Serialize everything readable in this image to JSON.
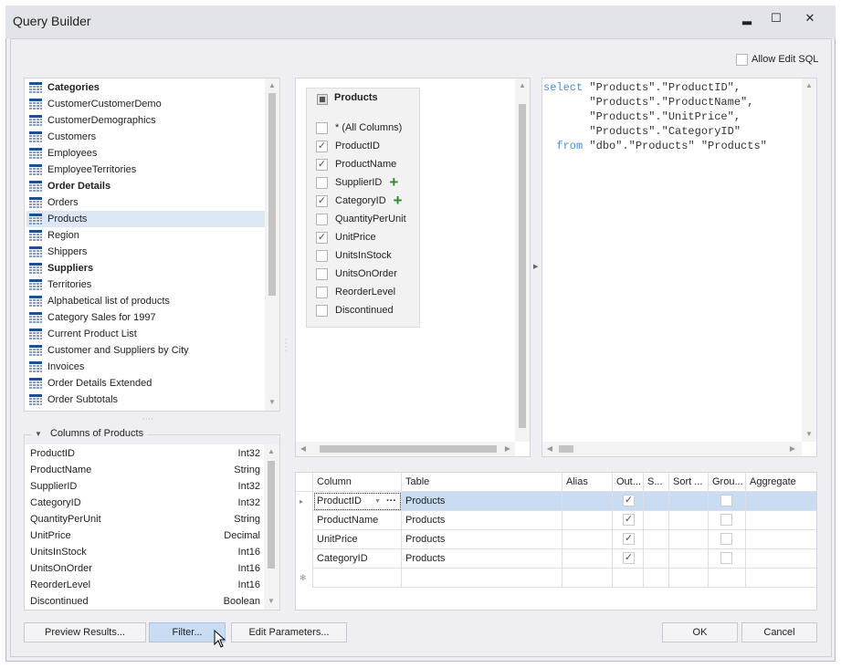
{
  "window": {
    "title": "Query Builder",
    "minimize": "▂",
    "maximize": "☐",
    "close": "✕"
  },
  "allow_edit_sql": {
    "label": "Allow Edit SQL",
    "checked": false
  },
  "tables": [
    {
      "label": "Categories",
      "bold": true
    },
    {
      "label": "CustomerCustomerDemo"
    },
    {
      "label": "CustomerDemographics"
    },
    {
      "label": "Customers"
    },
    {
      "label": "Employees"
    },
    {
      "label": "EmployeeTerritories"
    },
    {
      "label": "Order Details",
      "bold": true
    },
    {
      "label": "Orders"
    },
    {
      "label": "Products",
      "selected": true
    },
    {
      "label": "Region"
    },
    {
      "label": "Shippers"
    },
    {
      "label": "Suppliers",
      "bold": true
    },
    {
      "label": "Territories"
    },
    {
      "label": "Alphabetical list of products"
    },
    {
      "label": "Category Sales for 1997"
    },
    {
      "label": "Current Product List"
    },
    {
      "label": "Customer and Suppliers by City"
    },
    {
      "label": "Invoices"
    },
    {
      "label": "Order Details Extended"
    },
    {
      "label": "Order Subtotals"
    }
  ],
  "columns_group": {
    "title": "Columns of Products",
    "items": [
      {
        "name": "ProductID",
        "type": "Int32"
      },
      {
        "name": "ProductName",
        "type": "String"
      },
      {
        "name": "SupplierID",
        "type": "Int32"
      },
      {
        "name": "CategoryID",
        "type": "Int32"
      },
      {
        "name": "QuantityPerUnit",
        "type": "String"
      },
      {
        "name": "UnitPrice",
        "type": "Decimal"
      },
      {
        "name": "UnitsInStock",
        "type": "Int16"
      },
      {
        "name": "UnitsOnOrder",
        "type": "Int16"
      },
      {
        "name": "ReorderLevel",
        "type": "Int16"
      },
      {
        "name": "Discontinued",
        "type": "Boolean"
      }
    ]
  },
  "diagram": {
    "table": "Products",
    "fields": [
      {
        "name": "* (All Columns)",
        "checked": false
      },
      {
        "name": "ProductID",
        "checked": true
      },
      {
        "name": "ProductName",
        "checked": true
      },
      {
        "name": "SupplierID",
        "checked": false,
        "relation": true
      },
      {
        "name": "CategoryID",
        "checked": true,
        "relation": true
      },
      {
        "name": "QuantityPerUnit",
        "checked": false
      },
      {
        "name": "UnitPrice",
        "checked": true
      },
      {
        "name": "UnitsInStock",
        "checked": false
      },
      {
        "name": "UnitsOnOrder",
        "checked": false
      },
      {
        "name": "ReorderLevel",
        "checked": false
      },
      {
        "name": "Discontinued",
        "checked": false
      }
    ]
  },
  "sql": {
    "lines": [
      {
        "kw": "select",
        "text": " \"Products\".\"ProductID\","
      },
      {
        "kw": "",
        "text": "       \"Products\".\"ProductName\","
      },
      {
        "kw": "",
        "text": "       \"Products\".\"UnitPrice\","
      },
      {
        "kw": "",
        "text": "       \"Products\".\"CategoryID\""
      },
      {
        "kw": "  from",
        "text": " \"dbo\".\"Products\" \"Products\""
      }
    ]
  },
  "grid": {
    "headers": [
      "Column",
      "Table",
      "Alias",
      "Out...",
      "S...",
      "Sort ...",
      "Grou...",
      "Aggregate"
    ],
    "rows": [
      {
        "column": "ProductID",
        "table": "Products",
        "output": true,
        "group": false,
        "current": true
      },
      {
        "column": "ProductName",
        "table": "Products",
        "output": true,
        "group": false
      },
      {
        "column": "UnitPrice",
        "table": "Products",
        "output": true,
        "group": false
      },
      {
        "column": "CategoryID",
        "table": "Products",
        "output": true,
        "group": false
      }
    ],
    "new_row_marker": "✻",
    "current_marker": "▸"
  },
  "buttons": {
    "preview": "Preview Results...",
    "filter": "Filter...",
    "edit_params": "Edit Parameters...",
    "ok": "OK",
    "cancel": "Cancel"
  },
  "colors": {
    "selection": "#dde8f6",
    "grid_selection": "#c9dcf2",
    "sql_keyword": "#4a8fd8",
    "relation_plus": "#2d8a2d"
  }
}
